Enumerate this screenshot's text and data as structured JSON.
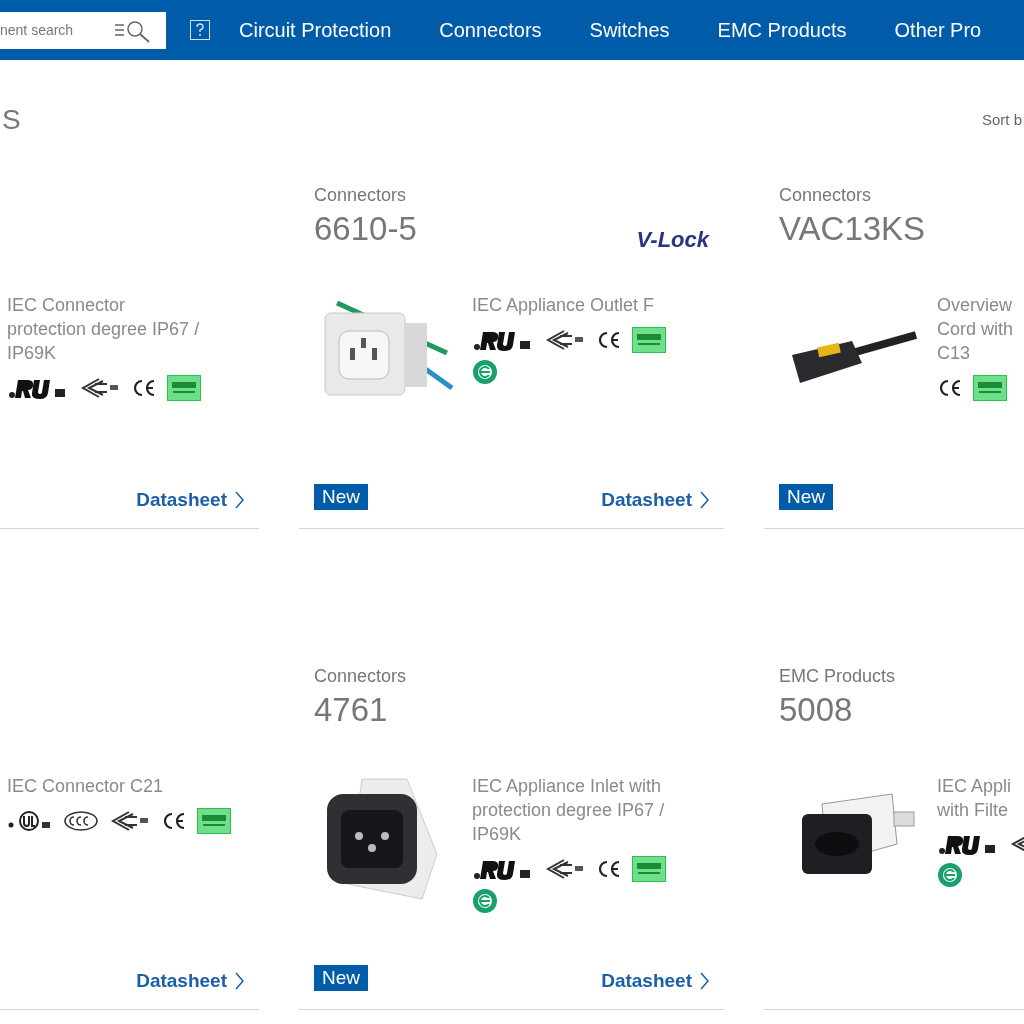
{
  "header": {
    "search": {
      "placeholder": "nent search"
    },
    "nav": [
      "Circuit Protection",
      "Connectors",
      "Switches",
      "EMC Products",
      "Other Pro"
    ]
  },
  "heading": "S",
  "sort_label": "Sort b",
  "rows": [
    {
      "cards": [
        {
          "description_lines": [
            "IEC Connector",
            "protection degree IP67 /",
            "IP69K"
          ],
          "cert_rows": [
            [
              {
                "kind": "ru"
              },
              {
                "kind": "enec"
              },
              {
                "kind": "ce"
              },
              {
                "kind": "rohs"
              }
            ]
          ],
          "datasheet": "Datasheet"
        },
        {
          "category": "Connectors",
          "number": "6610-5",
          "logo_text": "V-Lock",
          "photo": {
            "kind": "outlet"
          },
          "description_lines": [
            "IEC Appliance Outlet F"
          ],
          "cert_rows": [
            [
              {
                "kind": "ru"
              },
              {
                "kind": "enec"
              },
              {
                "kind": "ce"
              },
              {
                "kind": "rohs"
              }
            ],
            [
              {
                "kind": "e"
              }
            ]
          ],
          "badge": "New",
          "datasheet": "Datasheet"
        },
        {
          "category": "Connectors",
          "number": "VAC13KS",
          "photo": {
            "kind": "cord"
          },
          "description_lines": [
            "Overview",
            "Cord with",
            "C13"
          ],
          "cert_rows": [
            [
              {
                "kind": "ce"
              },
              {
                "kind": "rohs"
              }
            ]
          ],
          "badge": "New"
        }
      ]
    },
    {
      "cards": [
        {
          "description_lines": [
            "IEC Connector C21"
          ],
          "cert_rows": [
            [
              {
                "kind": "ulc"
              },
              {
                "kind": "ccc"
              },
              {
                "kind": "enec"
              },
              {
                "kind": "ce"
              },
              {
                "kind": "rohs"
              }
            ]
          ],
          "datasheet": "Datasheet"
        },
        {
          "category": "Connectors",
          "number": "4761",
          "photo": {
            "kind": "inlet"
          },
          "description_lines": [
            "IEC Appliance Inlet with",
            "protection degree IP67 /",
            "IP69K"
          ],
          "cert_rows": [
            [
              {
                "kind": "ru"
              },
              {
                "kind": "enec"
              },
              {
                "kind": "ce"
              },
              {
                "kind": "rohs"
              }
            ],
            [
              {
                "kind": "e"
              }
            ]
          ],
          "badge": "New",
          "datasheet": "Datasheet"
        },
        {
          "category": "EMC Products",
          "number": "5008",
          "photo": {
            "kind": "filter"
          },
          "description_lines": [
            "IEC Appli",
            "with Filte"
          ],
          "cert_rows": [
            [
              {
                "kind": "ru"
              },
              {
                "kind": "enec"
              }
            ],
            [
              {
                "kind": "e"
              }
            ]
          ]
        }
      ]
    }
  ]
}
